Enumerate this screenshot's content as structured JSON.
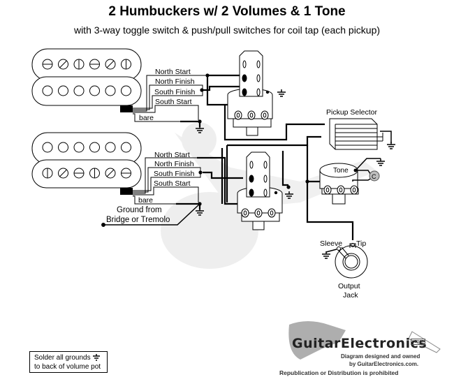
{
  "header": {
    "title": "2 Humbuckers w/ 2 Volumes & 1 Tone",
    "subtitle": "with 3-way toggle switch & push/pull switches for coil tap (each pickup)"
  },
  "pickups": [
    {
      "name": "neck-pickup",
      "leads": [
        "North Start",
        "North Finish",
        "South Finish",
        "South Start"
      ],
      "bare_label": "bare"
    },
    {
      "name": "bridge-pickup",
      "leads": [
        "North Start",
        "North Finish",
        "South Finish",
        "South Start"
      ],
      "bare_label": "bare"
    }
  ],
  "labels": {
    "ground_from": "Ground from",
    "bridge_or_tremolo": "Bridge or Tremolo",
    "pickup_selector": "Pickup Selector",
    "tone": "Tone",
    "capacitor": "C",
    "sleeve": "Sleeve",
    "tip": "Tip",
    "output": "Output",
    "jack": "Jack"
  },
  "note": {
    "line1": "Solder all grounds",
    "line2": "to back of volume pot"
  },
  "watermark": {
    "brand": "GuitarElectronics",
    "brand_suffix": ".com",
    "line1": "Diagram designed and owned",
    "line2": "by GuitarElectronics.com.",
    "line3": "Republication or Distribution is prohibited"
  },
  "colors": {
    "wire": "#000000",
    "background": "#ffffff",
    "watermark_gray": "#d8d8d8",
    "capacitor_fill": "#bdbdbd"
  }
}
